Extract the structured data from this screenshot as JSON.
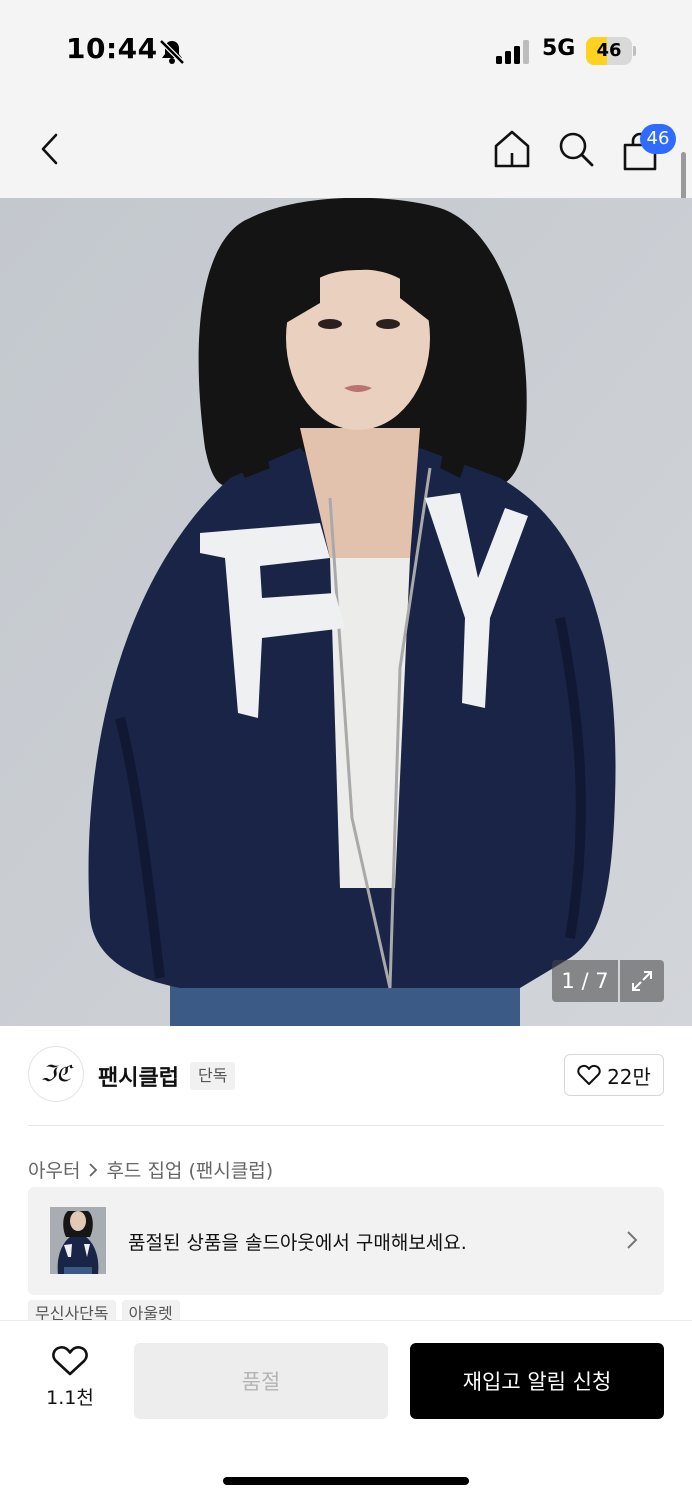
{
  "status_bar": {
    "time": "10:44",
    "network": "5G",
    "battery": "46",
    "battery_level": 0.46
  },
  "nav": {
    "back_icon": "chevron-left-icon",
    "home_icon": "home-icon",
    "search_icon": "search-icon",
    "cart_icon": "shopping-bag-icon",
    "cart_count": "46"
  },
  "gallery": {
    "counter": "1 / 7",
    "expand_icon": "expand-icon"
  },
  "brand": {
    "logo_text": "ℑℭ",
    "name": "팬시클럽",
    "badge": "단독",
    "likes": "22만"
  },
  "breadcrumb": {
    "category": "아우터",
    "subcategory": "후드 집업 (팬시클럽)"
  },
  "soldout_banner": {
    "text": "품절된 상품을 솔드아웃에서 구매해보세요."
  },
  "tags": [
    "무신사단독",
    "아울렛"
  ],
  "bottom_bar": {
    "wish_count": "1.1천",
    "soldout_label": "품절",
    "restock_label": "재입고 알림 신청"
  },
  "colors": {
    "accent_badge": "#2f6bff",
    "battery": "#ffd21f",
    "primary_button": "#000000"
  }
}
